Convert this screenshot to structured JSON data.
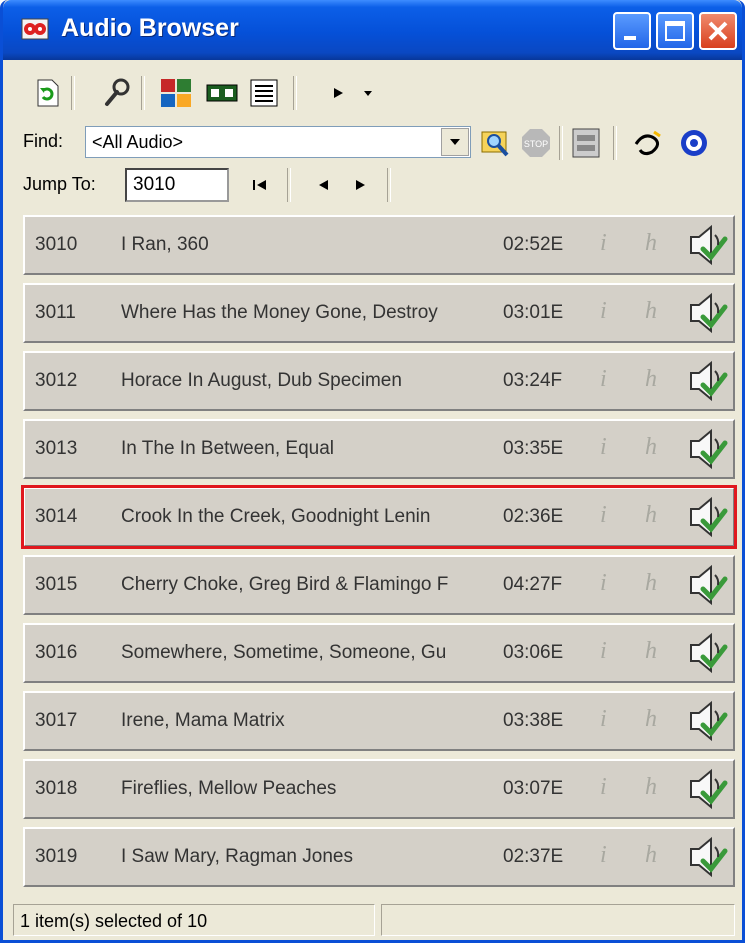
{
  "window": {
    "title": "Audio Browser"
  },
  "toolbar": {
    "tools": [
      "refresh-icon",
      "wrench-icon",
      "color-grid-icon",
      "tape-icon",
      "list-view-icon",
      "play-icon",
      "dropdown-arrow-icon"
    ]
  },
  "find": {
    "label": "Find:",
    "value": "<All Audio>"
  },
  "jump": {
    "label": "Jump To:",
    "value": "3010"
  },
  "rows": [
    {
      "num": "3010",
      "title": "I Ran, 360",
      "duration": "02:52E",
      "info": "i",
      "h": "h"
    },
    {
      "num": "3011",
      "title": "Where Has the Money Gone, Destroy",
      "duration": "03:01E",
      "info": "i",
      "h": "h"
    },
    {
      "num": "3012",
      "title": "Horace In August, Dub Specimen",
      "duration": "03:24F",
      "info": "i",
      "h": "h"
    },
    {
      "num": "3013",
      "title": "In The In Between, Equal",
      "duration": "03:35E",
      "info": "i",
      "h": "h"
    },
    {
      "num": "3014",
      "title": "Crook In the Creek, Goodnight Lenin",
      "duration": "02:36E",
      "info": "i",
      "h": "h"
    },
    {
      "num": "3015",
      "title": "Cherry Choke, Greg Bird & Flamingo F",
      "duration": "04:27F",
      "info": "i",
      "h": "h"
    },
    {
      "num": "3016",
      "title": "Somewhere, Sometime, Someone, Gu",
      "duration": "03:06E",
      "info": "i",
      "h": "h"
    },
    {
      "num": "3017",
      "title": "Irene, Mama Matrix",
      "duration": "03:38E",
      "info": "i",
      "h": "h"
    },
    {
      "num": "3018",
      "title": "Fireflies, Mellow Peaches",
      "duration": "03:07E",
      "info": "i",
      "h": "h"
    },
    {
      "num": "3019",
      "title": "I Saw Mary, Ragman Jones",
      "duration": "02:37E",
      "info": "i",
      "h": "h"
    }
  ],
  "selected_row": "3014",
  "status": {
    "text": "1 item(s) selected of 10"
  },
  "colors": {
    "title_bar": "#0550d8",
    "selection_outline": "#e0181e",
    "row_bg": "#d4d0c8"
  }
}
